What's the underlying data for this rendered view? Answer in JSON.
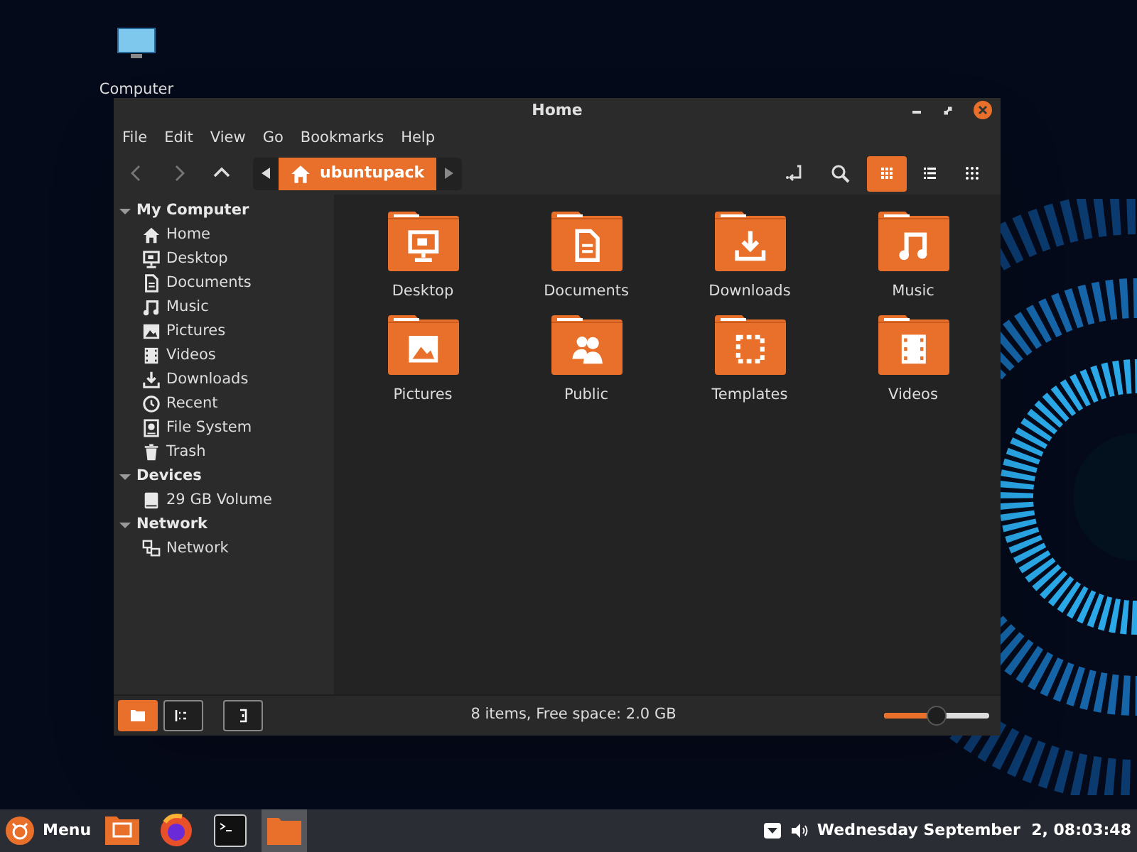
{
  "desktop_icons": [
    {
      "label": "Computer"
    }
  ],
  "window": {
    "title": "Home"
  },
  "menu": [
    "File",
    "Edit",
    "View",
    "Go",
    "Bookmarks",
    "Help"
  ],
  "toolbar": {
    "path_segment": "ubuntupack",
    "view_buttons": [
      {
        "kind": "icons",
        "selected": true
      },
      {
        "kind": "list",
        "selected": false
      },
      {
        "kind": "compact",
        "selected": false
      }
    ]
  },
  "sidebar": [
    {
      "title": "My Computer",
      "expanded": true,
      "items": [
        {
          "label": "Home",
          "kind": "home"
        },
        {
          "label": "Desktop",
          "kind": "desktop"
        },
        {
          "label": "Documents",
          "kind": "document"
        },
        {
          "label": "Music",
          "kind": "music"
        },
        {
          "label": "Pictures",
          "kind": "picture"
        },
        {
          "label": "Videos",
          "kind": "video"
        },
        {
          "label": "Downloads",
          "kind": "download"
        },
        {
          "label": "Recent",
          "kind": "recent"
        },
        {
          "label": "File System",
          "kind": "drive"
        },
        {
          "label": "Trash",
          "kind": "trash"
        }
      ]
    },
    {
      "title": "Devices",
      "expanded": true,
      "items": [
        {
          "label": "29 GB Volume",
          "kind": "volume"
        }
      ]
    },
    {
      "title": "Network",
      "expanded": true,
      "items": [
        {
          "label": "Network",
          "kind": "network"
        }
      ]
    }
  ],
  "files": [
    {
      "name": "Desktop",
      "kind": "desktop"
    },
    {
      "name": "Documents",
      "kind": "document"
    },
    {
      "name": "Downloads",
      "kind": "download"
    },
    {
      "name": "Music",
      "kind": "music"
    },
    {
      "name": "Pictures",
      "kind": "picture"
    },
    {
      "name": "Public",
      "kind": "people"
    },
    {
      "name": "Templates",
      "kind": "template"
    },
    {
      "name": "Videos",
      "kind": "video"
    }
  ],
  "status_bar": {
    "panel_buttons": [
      {
        "kind": "places",
        "selected": true
      },
      {
        "kind": "tree",
        "selected": false
      },
      {
        "kind": "hide",
        "selected": false
      }
    ],
    "text": "8 items, Free space: 2.0 GB",
    "zoom": {
      "level": 0.5
    }
  },
  "taskbar": {
    "menu_label": "Menu",
    "launchers": [
      {
        "kind": "files",
        "active": false
      },
      {
        "kind": "browser",
        "active": false
      },
      {
        "kind": "terminal",
        "active": false
      },
      {
        "kind": "folder",
        "active": true
      }
    ],
    "clock": "Wednesday September  2, 08:03:48"
  }
}
